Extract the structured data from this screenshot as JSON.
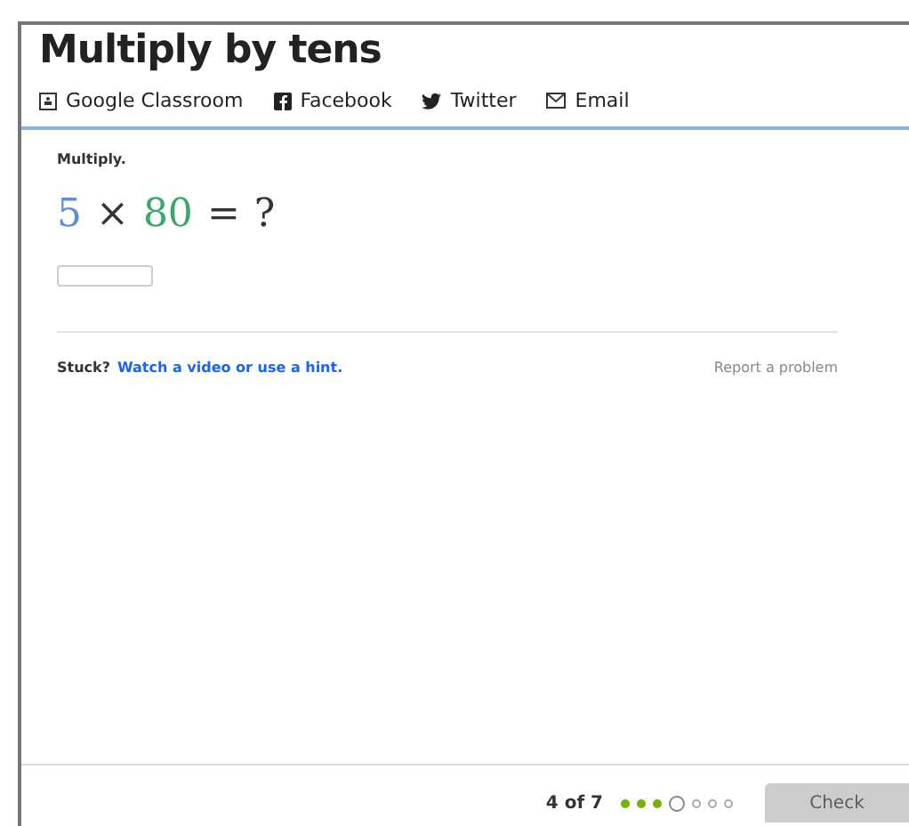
{
  "title": "Multiply by tens",
  "share": [
    {
      "kind": "classroom",
      "label": "Google Classroom"
    },
    {
      "kind": "facebook",
      "label": "Facebook"
    },
    {
      "kind": "twitter",
      "label": "Twitter"
    },
    {
      "kind": "email",
      "label": "Email"
    }
  ],
  "exercise": {
    "prompt": "Multiply.",
    "equation": [
      {
        "text": "5",
        "color": "#5a8fe0"
      },
      {
        "text": "×",
        "color": "#333333"
      },
      {
        "text": "80",
        "color": "#3aa76d"
      },
      {
        "text": "=",
        "color": "#333333"
      },
      {
        "text": "?",
        "color": "#333333"
      }
    ]
  },
  "help": {
    "stuck": "Stuck?",
    "link": "Watch a video or use a hint.",
    "report": "Report a problem"
  },
  "footer": {
    "progress": "4 of 7",
    "dots": [
      {
        "kind": "done"
      },
      {
        "kind": "done"
      },
      {
        "kind": "done"
      },
      {
        "kind": "current"
      },
      {
        "kind": "todo"
      },
      {
        "kind": "todo"
      },
      {
        "kind": "todo"
      }
    ],
    "check": {
      "label": "Check",
      "disabled": true
    }
  }
}
